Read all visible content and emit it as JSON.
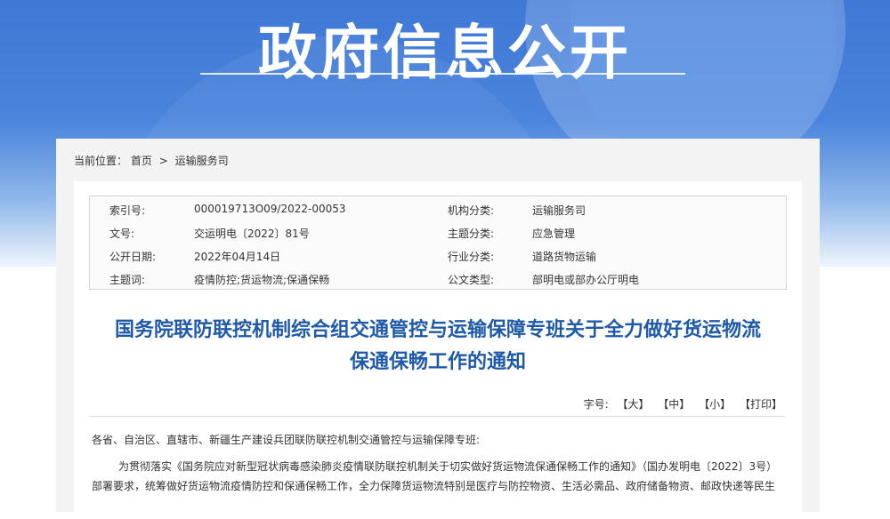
{
  "banner": {
    "title": "政府信息公开"
  },
  "breadcrumb": {
    "label": "当前位置：",
    "home": "首页",
    "separator": ">",
    "current": "运输服务司"
  },
  "meta": {
    "rows": [
      {
        "k1": "索引号:",
        "v1": "000019713O09/2022-00053",
        "k2": "机构分类:",
        "v2": "运输服务司"
      },
      {
        "k1": "文号:",
        "v1": "交运明电〔2022〕81号",
        "k2": "主题分类:",
        "v2": "应急管理"
      },
      {
        "k1": "公开日期:",
        "v1": "2022年04月14日",
        "k2": "行业分类:",
        "v2": "道路货物运输"
      },
      {
        "k1": "主题词:",
        "v1": "疫情防控;货运物流;保通保畅",
        "k2": "公文类型:",
        "v2": "部明电或部办公厅明电"
      }
    ]
  },
  "document": {
    "title_line1": "国务院联防联控机制综合组交通管控与运输保障专班关于全力做好货运物流",
    "title_line2": "保通保畅工作的通知",
    "font_label": "字号:",
    "font_large": "【大】",
    "font_medium": "【中】",
    "font_small": "【小】",
    "print": "【打印】",
    "salutation": "各省、自治区、直辖市、新疆生产建设兵团联防联控机制交通管控与运输保障专班:",
    "paragraph1": "为贯彻落实《国务院应对新型冠状病毒感染肺炎疫情联防联控机制关于切实做好货运物流保通保畅工作的通知》（国办发明电〔2022〕3号）部署要求，统筹做好货运物流疫情防控和保通保畅工作，全力保障货运物流特别是医疗与防控物资、生活必需品、政府储备物资、邮政快递等民生"
  }
}
